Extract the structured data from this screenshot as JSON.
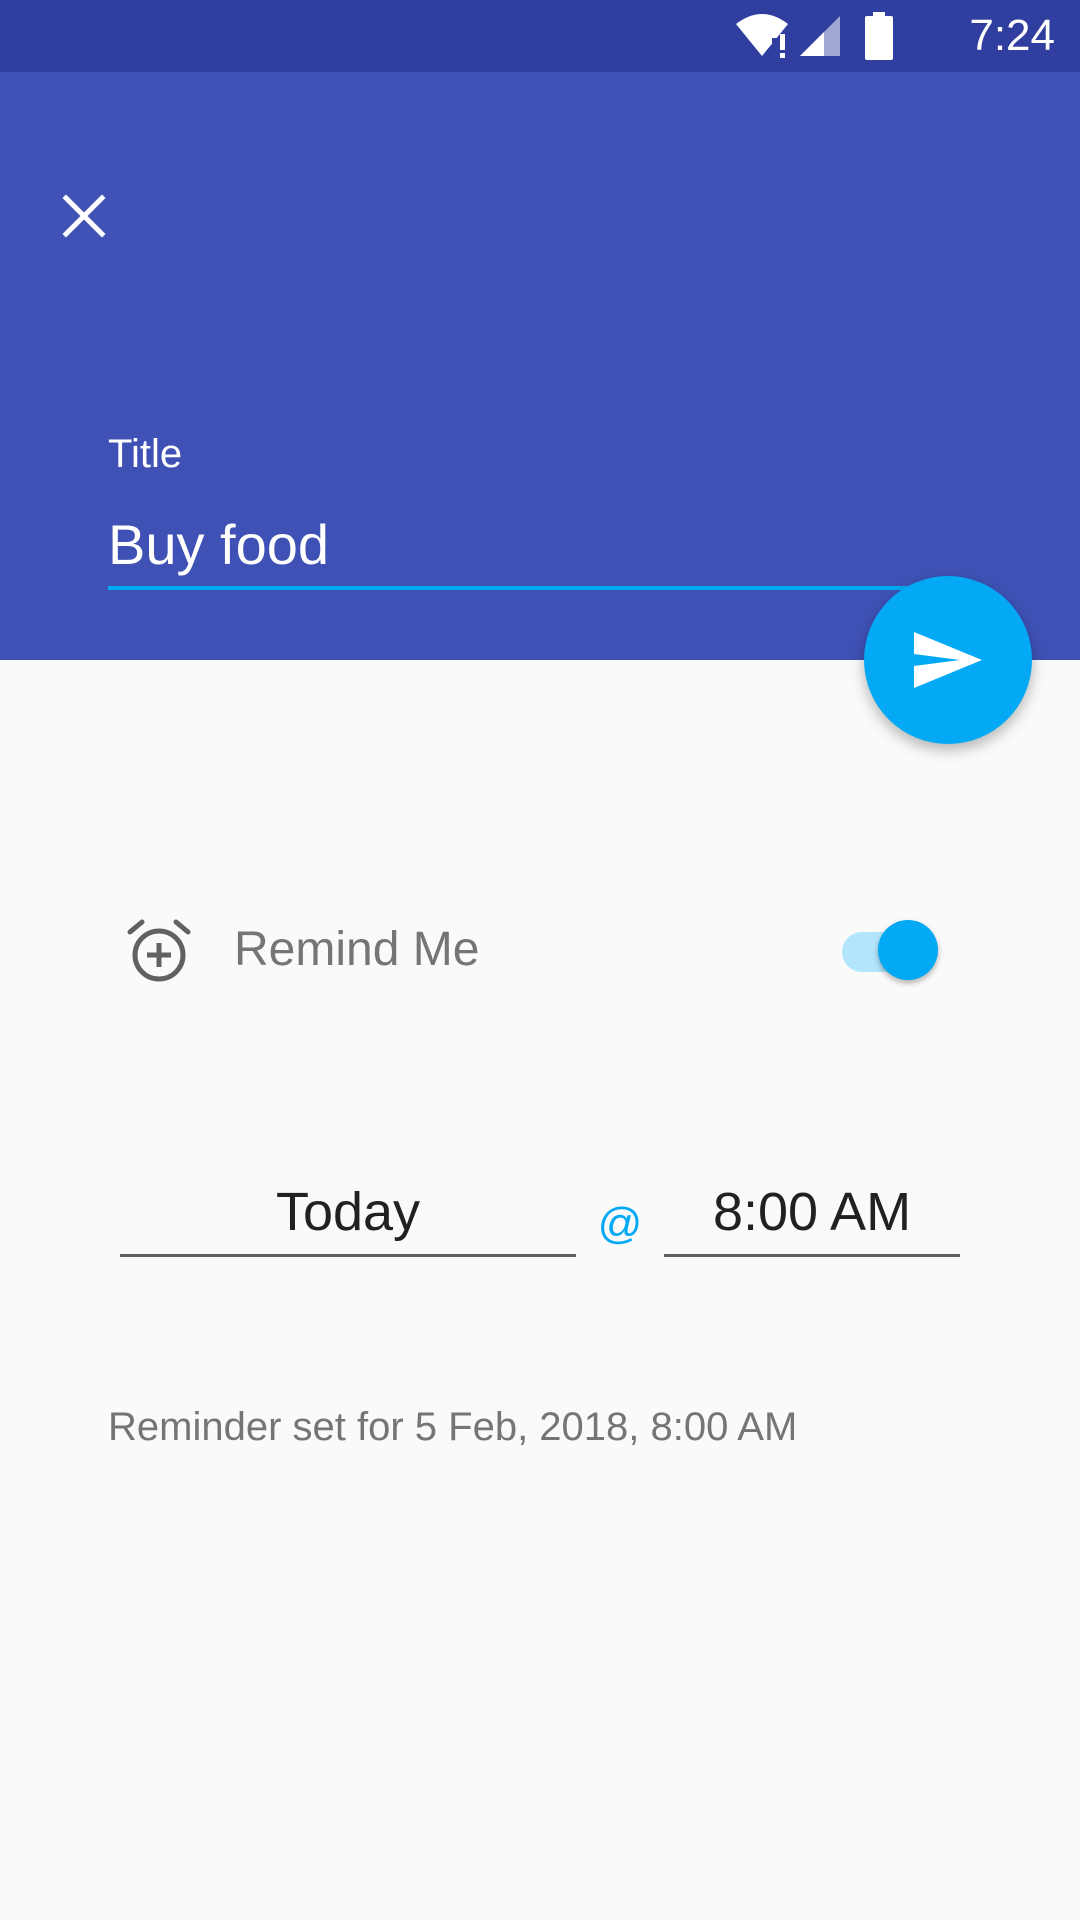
{
  "status_bar": {
    "time": "7:24",
    "icons": [
      "wifi-icon",
      "signal-icon",
      "battery-icon"
    ]
  },
  "header": {
    "close_icon": "close-icon",
    "title_label": "Title",
    "title_value": "Buy food"
  },
  "fab": {
    "icon": "send-icon"
  },
  "reminder": {
    "icon": "alarm-add-icon",
    "label": "Remind Me",
    "enabled": true,
    "date": "Today",
    "at": "@",
    "time": "8:00 AM",
    "summary": "Reminder set for 5 Feb, 2018, 8:00 AM"
  },
  "colors": {
    "primary": "#3F51B5",
    "primary_dark": "#303F9F",
    "accent": "#03A9F4",
    "accent_light": "#B3E5FC",
    "background": "#FAFAFA",
    "text_secondary": "#757575"
  }
}
